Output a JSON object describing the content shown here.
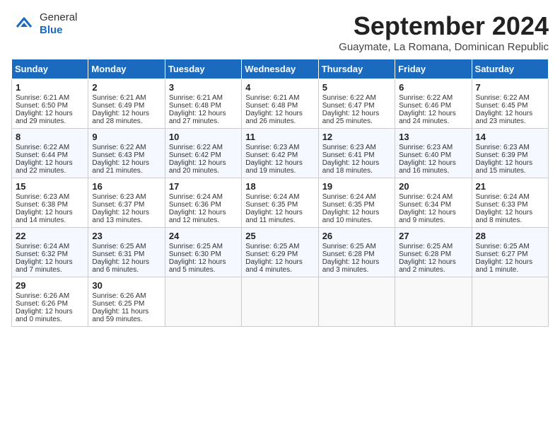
{
  "header": {
    "logo_general": "General",
    "logo_blue": "Blue",
    "title": "September 2024",
    "subtitle": "Guaymate, La Romana, Dominican Republic"
  },
  "weekdays": [
    "Sunday",
    "Monday",
    "Tuesday",
    "Wednesday",
    "Thursday",
    "Friday",
    "Saturday"
  ],
  "weeks": [
    [
      {
        "day": "1",
        "sunrise": "6:21 AM",
        "sunset": "6:50 PM",
        "daylight": "12 hours and 29 minutes."
      },
      {
        "day": "2",
        "sunrise": "6:21 AM",
        "sunset": "6:49 PM",
        "daylight": "12 hours and 28 minutes."
      },
      {
        "day": "3",
        "sunrise": "6:21 AM",
        "sunset": "6:48 PM",
        "daylight": "12 hours and 27 minutes."
      },
      {
        "day": "4",
        "sunrise": "6:21 AM",
        "sunset": "6:48 PM",
        "daylight": "12 hours and 26 minutes."
      },
      {
        "day": "5",
        "sunrise": "6:22 AM",
        "sunset": "6:47 PM",
        "daylight": "12 hours and 25 minutes."
      },
      {
        "day": "6",
        "sunrise": "6:22 AM",
        "sunset": "6:46 PM",
        "daylight": "12 hours and 24 minutes."
      },
      {
        "day": "7",
        "sunrise": "6:22 AM",
        "sunset": "6:45 PM",
        "daylight": "12 hours and 23 minutes."
      }
    ],
    [
      {
        "day": "8",
        "sunrise": "6:22 AM",
        "sunset": "6:44 PM",
        "daylight": "12 hours and 22 minutes."
      },
      {
        "day": "9",
        "sunrise": "6:22 AM",
        "sunset": "6:43 PM",
        "daylight": "12 hours and 21 minutes."
      },
      {
        "day": "10",
        "sunrise": "6:22 AM",
        "sunset": "6:42 PM",
        "daylight": "12 hours and 20 minutes."
      },
      {
        "day": "11",
        "sunrise": "6:23 AM",
        "sunset": "6:42 PM",
        "daylight": "12 hours and 19 minutes."
      },
      {
        "day": "12",
        "sunrise": "6:23 AM",
        "sunset": "6:41 PM",
        "daylight": "12 hours and 18 minutes."
      },
      {
        "day": "13",
        "sunrise": "6:23 AM",
        "sunset": "6:40 PM",
        "daylight": "12 hours and 16 minutes."
      },
      {
        "day": "14",
        "sunrise": "6:23 AM",
        "sunset": "6:39 PM",
        "daylight": "12 hours and 15 minutes."
      }
    ],
    [
      {
        "day": "15",
        "sunrise": "6:23 AM",
        "sunset": "6:38 PM",
        "daylight": "12 hours and 14 minutes."
      },
      {
        "day": "16",
        "sunrise": "6:23 AM",
        "sunset": "6:37 PM",
        "daylight": "12 hours and 13 minutes."
      },
      {
        "day": "17",
        "sunrise": "6:24 AM",
        "sunset": "6:36 PM",
        "daylight": "12 hours and 12 minutes."
      },
      {
        "day": "18",
        "sunrise": "6:24 AM",
        "sunset": "6:35 PM",
        "daylight": "12 hours and 11 minutes."
      },
      {
        "day": "19",
        "sunrise": "6:24 AM",
        "sunset": "6:35 PM",
        "daylight": "12 hours and 10 minutes."
      },
      {
        "day": "20",
        "sunrise": "6:24 AM",
        "sunset": "6:34 PM",
        "daylight": "12 hours and 9 minutes."
      },
      {
        "day": "21",
        "sunrise": "6:24 AM",
        "sunset": "6:33 PM",
        "daylight": "12 hours and 8 minutes."
      }
    ],
    [
      {
        "day": "22",
        "sunrise": "6:24 AM",
        "sunset": "6:32 PM",
        "daylight": "12 hours and 7 minutes."
      },
      {
        "day": "23",
        "sunrise": "6:25 AM",
        "sunset": "6:31 PM",
        "daylight": "12 hours and 6 minutes."
      },
      {
        "day": "24",
        "sunrise": "6:25 AM",
        "sunset": "6:30 PM",
        "daylight": "12 hours and 5 minutes."
      },
      {
        "day": "25",
        "sunrise": "6:25 AM",
        "sunset": "6:29 PM",
        "daylight": "12 hours and 4 minutes."
      },
      {
        "day": "26",
        "sunrise": "6:25 AM",
        "sunset": "6:28 PM",
        "daylight": "12 hours and 3 minutes."
      },
      {
        "day": "27",
        "sunrise": "6:25 AM",
        "sunset": "6:28 PM",
        "daylight": "12 hours and 2 minutes."
      },
      {
        "day": "28",
        "sunrise": "6:25 AM",
        "sunset": "6:27 PM",
        "daylight": "12 hours and 1 minute."
      }
    ],
    [
      {
        "day": "29",
        "sunrise": "6:26 AM",
        "sunset": "6:26 PM",
        "daylight": "12 hours and 0 minutes."
      },
      {
        "day": "30",
        "sunrise": "6:26 AM",
        "sunset": "6:25 PM",
        "daylight": "11 hours and 59 minutes."
      },
      null,
      null,
      null,
      null,
      null
    ]
  ]
}
